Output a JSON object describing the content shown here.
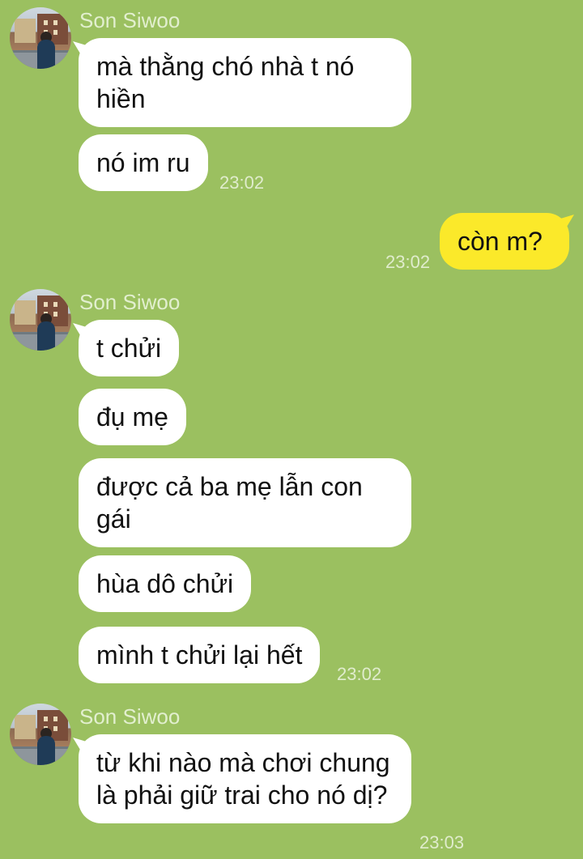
{
  "colors": {
    "background": "#9bc060",
    "incoming_bubble": "#ffffff",
    "outgoing_bubble": "#fbe92a",
    "meta_text": "#e2efcf"
  },
  "groups": [
    {
      "sender": "Son Siwoo",
      "messages": [
        {
          "text": "mà thằng chó nhà t nó hiền"
        },
        {
          "text": "nó im ru",
          "time": "23:02"
        }
      ]
    },
    {
      "sender": "me",
      "messages": [
        {
          "text": "còn m?",
          "time": "23:02"
        }
      ]
    },
    {
      "sender": "Son Siwoo",
      "messages": [
        {
          "text": "t chửi"
        },
        {
          "text": "đụ mẹ"
        },
        {
          "text": "được cả ba mẹ lẫn con gái"
        },
        {
          "text": "hùa dô chửi"
        },
        {
          "text": "mình t chửi lại hết",
          "time": "23:02"
        }
      ]
    },
    {
      "sender": "Son Siwoo",
      "messages": [
        {
          "text": "từ khi nào mà chơi chung là phải giữ trai cho nó dị?",
          "time": "23:03"
        }
      ]
    }
  ]
}
